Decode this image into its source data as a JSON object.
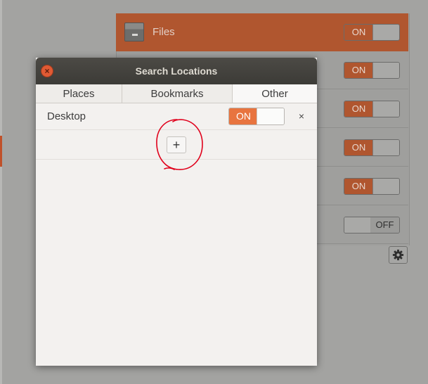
{
  "background_panel": {
    "rows": [
      {
        "label": "Files",
        "switch_label": "ON",
        "state": "on",
        "selected": true
      },
      {
        "label": "",
        "switch_label": "ON",
        "state": "on"
      },
      {
        "label": "",
        "switch_label": "ON",
        "state": "on"
      },
      {
        "label": "",
        "switch_label": "ON",
        "state": "on"
      },
      {
        "label": "",
        "switch_label": "ON",
        "state": "on"
      },
      {
        "label": "",
        "switch_label": "OFF",
        "state": "off"
      }
    ],
    "gear_icon": "gear-icon"
  },
  "dialog": {
    "title": "Search Locations",
    "tabs": [
      {
        "label": "Places"
      },
      {
        "label": "Bookmarks"
      },
      {
        "label": "Other",
        "active": true
      }
    ],
    "locations": [
      {
        "label": "Desktop",
        "switch_label": "ON",
        "remove_label": "×"
      }
    ],
    "add_label": "+"
  },
  "colors": {
    "accent": "#e8743f",
    "close": "#e05a34",
    "annotation": "#e0001b"
  }
}
